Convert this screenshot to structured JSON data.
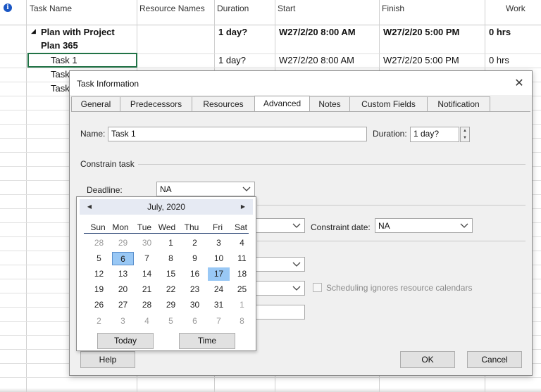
{
  "grid": {
    "columns": [
      "Task Name",
      "Resource Names",
      "Duration",
      "Start",
      "Finish",
      "Work"
    ],
    "summary_row": {
      "name_line1": "Plan with Project",
      "name_line2": "Plan 365",
      "resource": "",
      "duration": "1 day?",
      "start": "W27/2/20 8:00 AM",
      "finish": "W27/2/20 5:00 PM",
      "work": "0 hrs"
    },
    "task_rows": [
      {
        "name": "Task 1",
        "duration": "1 day?",
        "start": "W27/2/20 8:00 AM",
        "finish": "W27/2/20 5:00 PM",
        "work": "0 hrs"
      },
      {
        "name": "Task",
        "duration": "",
        "start": "",
        "finish": "",
        "work": ""
      },
      {
        "name": "Task",
        "duration": "",
        "start": "",
        "finish": "",
        "work": ""
      }
    ],
    "info_icon": "info-icon",
    "selection_color": "#217346"
  },
  "dialog": {
    "title": "Task Information",
    "close_glyph": "✕",
    "tabs": [
      {
        "label": "General",
        "active": false
      },
      {
        "label": "Predecessors",
        "active": false
      },
      {
        "label": "Resources",
        "active": false
      },
      {
        "label": "Advanced",
        "active": true
      },
      {
        "label": "Notes",
        "active": false
      },
      {
        "label": "Custom Fields",
        "active": false
      },
      {
        "label": "Notification",
        "active": false
      }
    ],
    "name_label": "Name:",
    "name_value": "Task 1",
    "duration_label": "Duration:",
    "duration_value": "1 day?",
    "constrain_section": "Constrain task",
    "deadline_label": "Deadline:",
    "deadline_value": "NA",
    "constraint_date_label": "Constraint date:",
    "constraint_date_value": "NA",
    "scheduling_label": "Scheduling ignores resource calendars",
    "help_label": "Help",
    "ok_label": "OK",
    "cancel_label": "Cancel"
  },
  "calendar": {
    "month": "July, 2020",
    "prev_glyph": "◀",
    "next_glyph": "▶",
    "weekdays": [
      "Sun",
      "Mon",
      "Tue",
      "Wed",
      "Thu",
      "Fri",
      "Sat"
    ],
    "weeks": [
      [
        {
          "d": "28",
          "m": true
        },
        {
          "d": "29",
          "m": true
        },
        {
          "d": "30",
          "m": true
        },
        {
          "d": "1"
        },
        {
          "d": "2"
        },
        {
          "d": "3"
        },
        {
          "d": "4"
        }
      ],
      [
        {
          "d": "5"
        },
        {
          "d": "6",
          "today": true
        },
        {
          "d": "7"
        },
        {
          "d": "8"
        },
        {
          "d": "9"
        },
        {
          "d": "10"
        },
        {
          "d": "11"
        }
      ],
      [
        {
          "d": "12"
        },
        {
          "d": "13"
        },
        {
          "d": "14"
        },
        {
          "d": "15"
        },
        {
          "d": "16"
        },
        {
          "d": "17",
          "sel": true
        },
        {
          "d": "18"
        }
      ],
      [
        {
          "d": "19"
        },
        {
          "d": "20"
        },
        {
          "d": "21"
        },
        {
          "d": "22"
        },
        {
          "d": "23"
        },
        {
          "d": "24"
        },
        {
          "d": "25"
        }
      ],
      [
        {
          "d": "26"
        },
        {
          "d": "27"
        },
        {
          "d": "28"
        },
        {
          "d": "29"
        },
        {
          "d": "30"
        },
        {
          "d": "31"
        },
        {
          "d": "1",
          "m": true
        }
      ],
      [
        {
          "d": "2",
          "m": true
        },
        {
          "d": "3",
          "m": true
        },
        {
          "d": "4",
          "m": true
        },
        {
          "d": "5",
          "m": true
        },
        {
          "d": "6",
          "m": true
        },
        {
          "d": "7",
          "m": true
        },
        {
          "d": "8",
          "m": true
        }
      ]
    ],
    "today_button": "Today",
    "time_button": "Time"
  }
}
